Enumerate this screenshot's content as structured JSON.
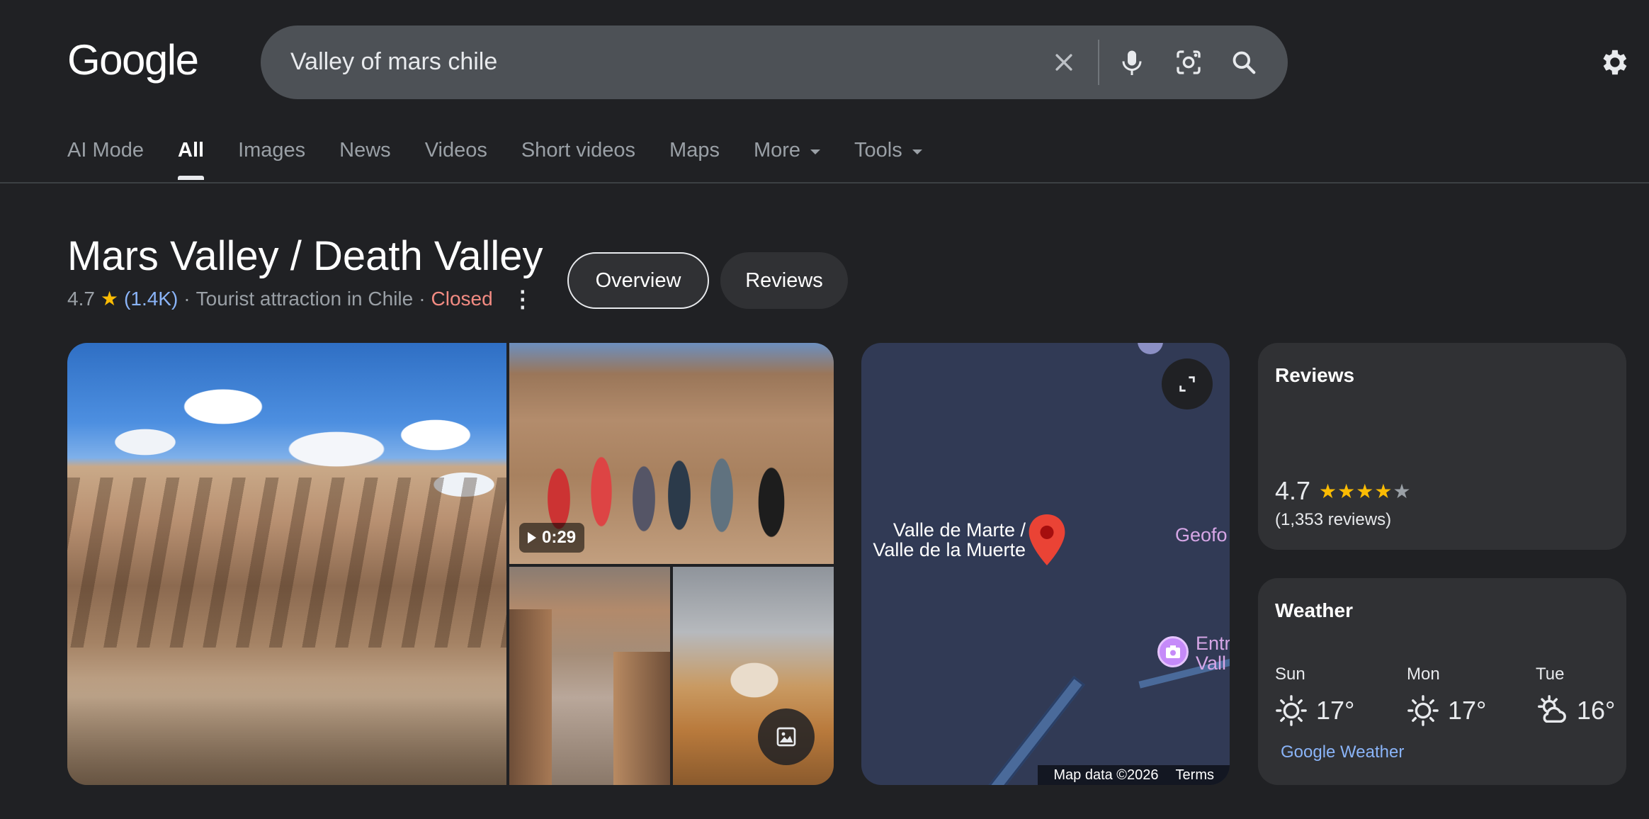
{
  "header": {
    "logo": "Google",
    "search_query": "Valley of mars chile"
  },
  "tabs": [
    {
      "label": "AI Mode",
      "active": false
    },
    {
      "label": "All",
      "active": true
    },
    {
      "label": "Images",
      "active": false
    },
    {
      "label": "News",
      "active": false
    },
    {
      "label": "Videos",
      "active": false
    },
    {
      "label": "Short videos",
      "active": false
    },
    {
      "label": "Maps",
      "active": false
    },
    {
      "label": "More",
      "active": false
    },
    {
      "label": "Tools",
      "active": false
    }
  ],
  "place": {
    "title": "Mars Valley / Death Valley",
    "rating": "4.7",
    "rating_count": "(1.4K)",
    "category": "Tourist attraction in Chile",
    "status": "Closed",
    "sep": "·",
    "buttons": {
      "overview": "Overview",
      "reviews": "Reviews"
    }
  },
  "photos": {
    "video_duration": "0:29"
  },
  "map": {
    "place_label_line1": "Valle de Marte /",
    "place_label_line2": "Valle de la Muerte",
    "poi_1": "Geofo",
    "poi_2_line1": "Entr",
    "poi_2_line2": "Vall",
    "footer_data": "Map data ©2026",
    "footer_terms": "Terms"
  },
  "reviews_card": {
    "title": "Reviews",
    "score": "4.7",
    "count": "(1,353 reviews)"
  },
  "weather_card": {
    "title": "Weather",
    "days": [
      {
        "day": "Sun",
        "temp": "17°",
        "icon": "sun-icon"
      },
      {
        "day": "Mon",
        "temp": "17°",
        "icon": "sun-icon"
      },
      {
        "day": "Tue",
        "temp": "16°",
        "icon": "partly-cloudy-icon"
      }
    ],
    "source_link": "Google Weather"
  },
  "colors": {
    "background": "#202124",
    "link": "#8ab4f8",
    "closed": "#f28b82",
    "star": "#fbbc04"
  }
}
